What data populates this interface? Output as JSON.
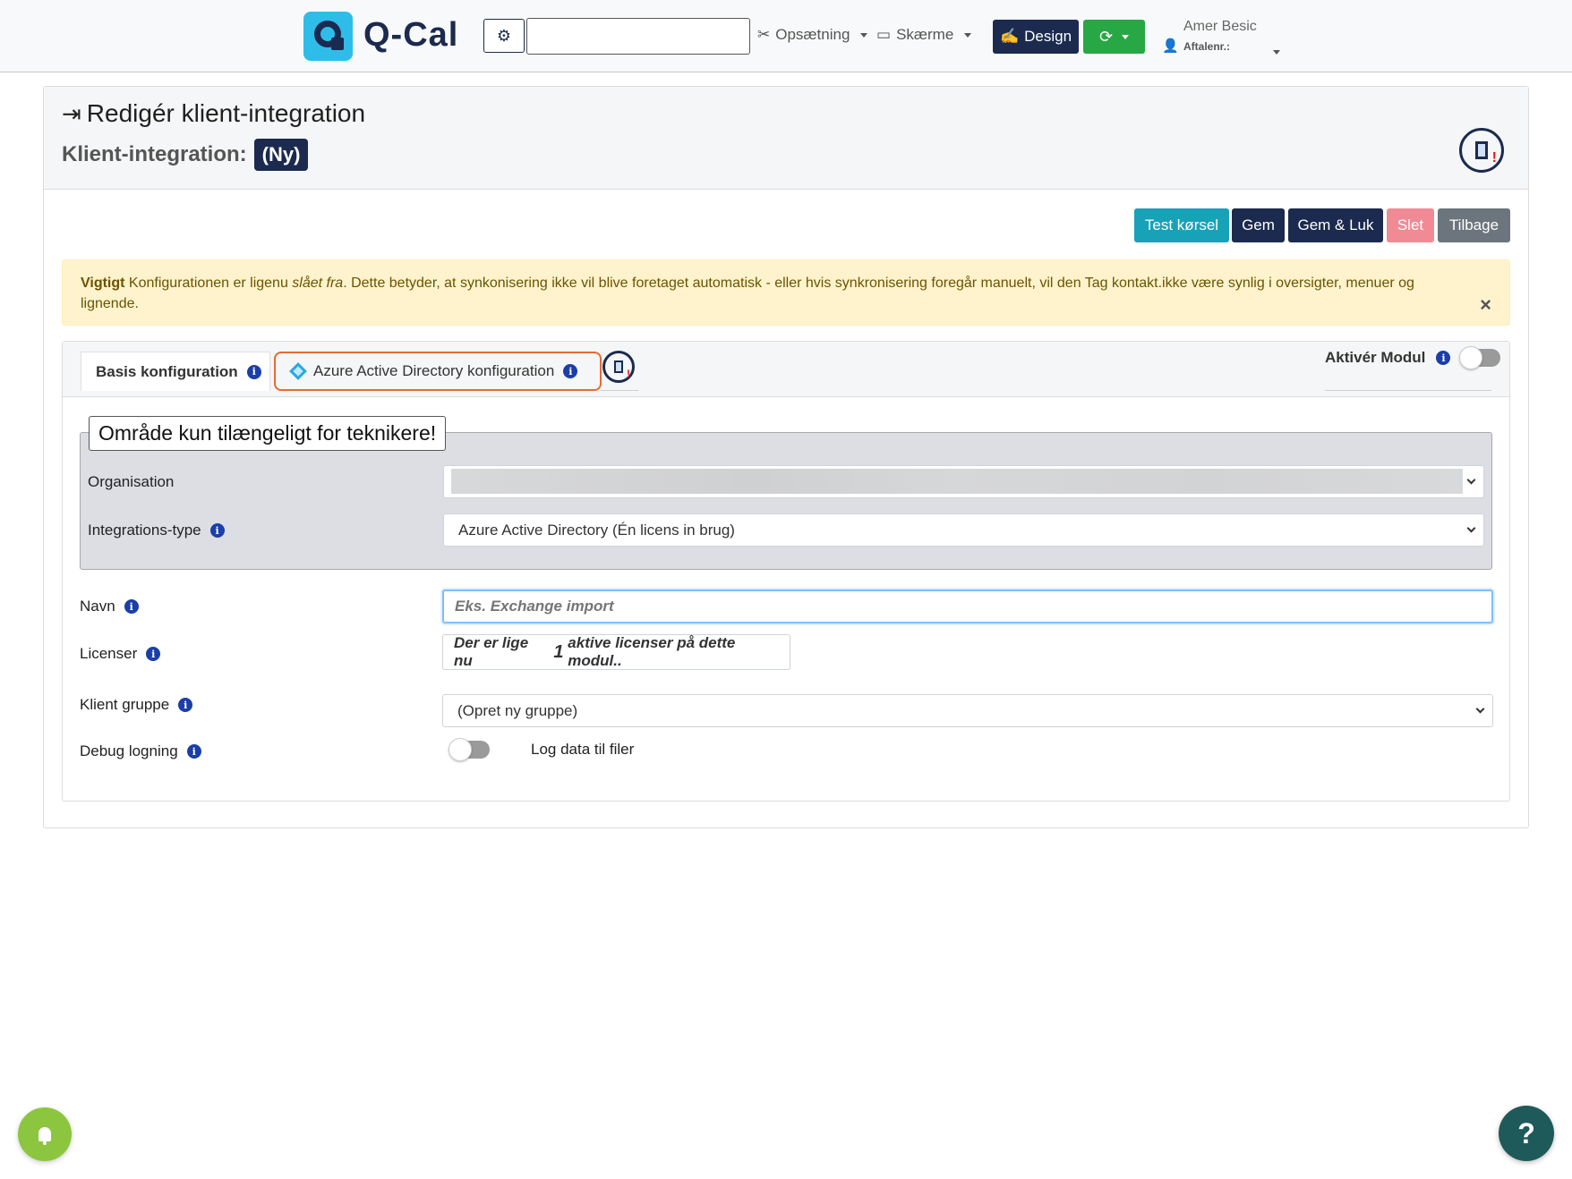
{
  "app": {
    "name": "Q-Cal"
  },
  "navbar": {
    "search_value": "",
    "setup_label": "Opsætning",
    "screens_label": "Skærme",
    "design_label": "Design",
    "user_name": "Amer Besic",
    "user_sub": "Aftalenr.:"
  },
  "page": {
    "title": "Redigér klient-integration",
    "subtitle_label": "Klient-integration:",
    "subtitle_badge": "(Ny)"
  },
  "actions": {
    "test": "Test kørsel",
    "save": "Gem",
    "save_close": "Gem & Luk",
    "delete": "Slet",
    "back": "Tilbage"
  },
  "alert": {
    "strong": "Vigtigt",
    "text_before": " Konfigurationen er ligenu ",
    "emphasis": "slået fra",
    "text_after": ". Dette betyder, at synkonisering ikke vil blive foretaget automatisk - eller hvis synkronisering foregår manuelt, vil den Tag kontakt.ikke være synlig i oversigter, menuer og lignende.",
    "close": "×"
  },
  "tabs": {
    "basis": "Basis konfiguration",
    "azure": "Azure Active Directory konfiguration",
    "activate_label": "Aktivér Modul",
    "activate_on": false
  },
  "tech": {
    "legend": "Område kun tilængeligt for teknikere!",
    "organisation_label": "Organisation",
    "organisation_value": "",
    "integration_type_label": "Integrations-type",
    "integration_type_value": "Azure Active Directory (Én licens in brug)"
  },
  "form": {
    "name_label": "Navn",
    "name_placeholder": "Eks. Exchange import",
    "name_value": "",
    "licenses_label": "Licenser",
    "licenses_prefix": "Der er lige nu ",
    "licenses_count": "1",
    "licenses_suffix": " aktive licenser på dette modul..",
    "group_label": "Klient gruppe",
    "group_value": "(Opret ny gruppe)",
    "debug_label": "Debug logning",
    "debug_text": "Log data til filer",
    "debug_on": false
  },
  "floating": {
    "help": "?"
  },
  "colors": {
    "primary": "#1b2a4e",
    "accent": "#2ebde9",
    "info_btn": "#17a2b8",
    "success": "#28a745",
    "danger_light": "#f08a94",
    "secondary": "#6c757d",
    "warning_bg": "#fff3cd",
    "tab_highlight": "#e86a33"
  }
}
